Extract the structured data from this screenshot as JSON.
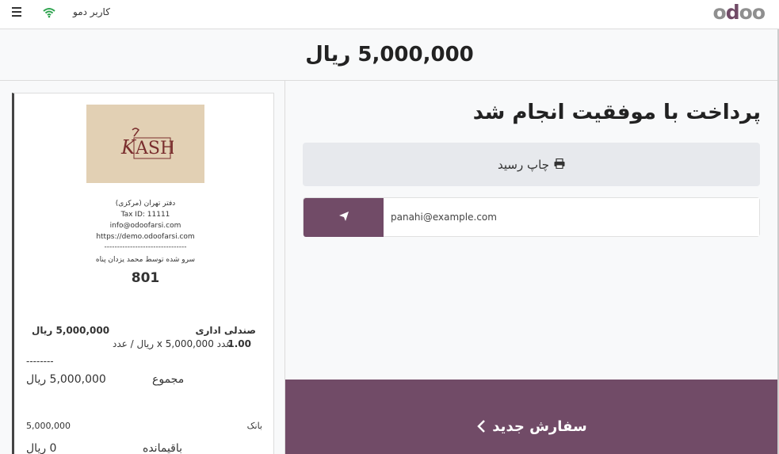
{
  "topbar": {
    "username": "کاربر دمو",
    "logo": "odoo",
    "menu_icon": "hamburger-menu-icon",
    "status_icon": "wifi-icon"
  },
  "amount_due": "5,000,000 ریال",
  "receipt": {
    "logo_text": "KASH",
    "company_branch": "دفتر تهران (مرکزی)",
    "tax_id": "Tax ID: 11111",
    "email": "info@odoofarsi.com",
    "website": "https://demo.odoofarsi.com",
    "separator": "--------------------------------",
    "served_by": "سرو شده توسط محمد یزدان پناه",
    "order_number": "801",
    "line": {
      "product": "صندلی اداری",
      "price": "5,000,000 ریال",
      "quantity": "1.00",
      "qty_detail": "عدد 5,000,000 x ریال / عدد"
    },
    "dash": "--------",
    "total_label": "مجموع",
    "total_value": "5,000,000 ریال",
    "payment_method": "بانک",
    "payment_value": "5,000,000",
    "change_label": "باقیمانده",
    "change_value": "0 ریال"
  },
  "payment_result": {
    "title": "پرداخت با موفقیت انجام شد",
    "print_label": "چاپ رسید",
    "email_value": "panahi@example.com",
    "new_order_label": "سفارش جدید"
  },
  "colors": {
    "primary": "#714b67",
    "wifi": "#2ea44f"
  }
}
